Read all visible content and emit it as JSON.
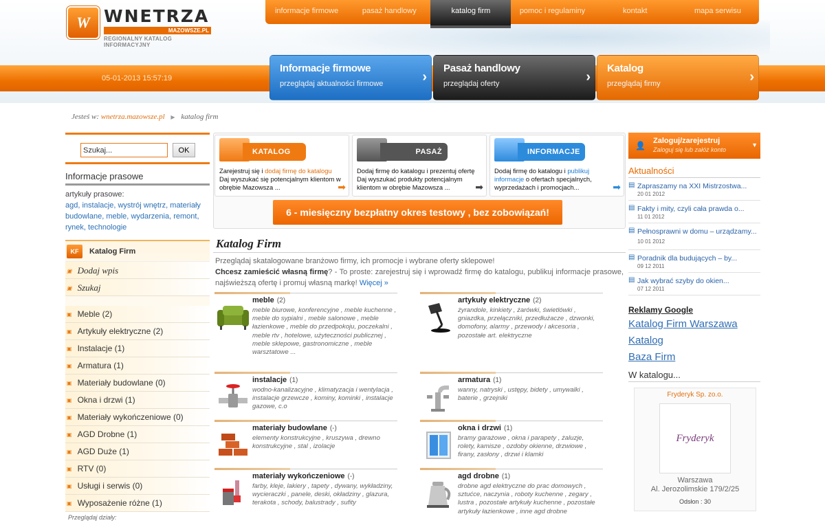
{
  "logo": {
    "word": "WNETRZA",
    "sub": "MAZOWSZE.PL",
    "tagline": "REGIONALNY KATALOG INFORMACYJNY"
  },
  "topnav": [
    {
      "label": "informacje firmowe",
      "active": false
    },
    {
      "label": "pasaż handlowy",
      "active": false
    },
    {
      "label": "katalog firm",
      "active": true
    },
    {
      "label": "pomoc i regulaminy",
      "active": false
    },
    {
      "label": "kontakt",
      "active": false
    },
    {
      "label": "mapa serwisu",
      "active": false
    }
  ],
  "datetime": "05-01-2013 15:57:19",
  "bigtabs": [
    {
      "title": "Informacje firmowe",
      "subtitle": "przeglądaj aktualności firmowe"
    },
    {
      "title": "Pasaż handlowy",
      "subtitle": "przeglądaj oferty"
    },
    {
      "title": "Katalog",
      "subtitle": "przeglądaj firmy"
    }
  ],
  "breadcrumb": {
    "prefix": "Jesteś w:",
    "home": "wnetrza.mazowsze.pl",
    "current": "katalog firm"
  },
  "search": {
    "placeholder": "Szukaj...",
    "value": "Szukaj...",
    "button": "OK"
  },
  "press": {
    "title": "Informacje prasowe",
    "subtitle": "artykuły prasowe:",
    "tags": [
      "agd,",
      "instalacje,",
      "wystrój wnętrz,",
      "materiały budowlane,",
      "meble,",
      "wydarzenia,",
      "remont,",
      "rynek,",
      "technologie"
    ]
  },
  "catalog_panel": {
    "title": "Katalog Firm",
    "badge": "KF",
    "actions": [
      "Dodaj wpis",
      "Szukaj"
    ],
    "categories": [
      "Meble (2)",
      "Artykuły elektryczne (2)",
      "Instalacje (1)",
      "Armatura (1)",
      "Materiały budowlane (0)",
      "Okna i drzwi (1)",
      "Materiały wykończeniowe (0)",
      "AGD Drobne (1)",
      "AGD Duże (1)",
      "RTV (0)",
      "Usługi i serwis (0)",
      "Wyposażenie różne (1)"
    ],
    "footer": "Przeglądaj działy:"
  },
  "promos": [
    {
      "label": "KATALOG",
      "pre": "Zarejestruj się i ",
      "hl": "dodaj firmę do katalogu",
      "post": " Daj wyszukać się potencjalnym klientom w obrębie Mazowsza ...",
      "color": "#f07a12",
      "arrow_color": "#f07a12"
    },
    {
      "label": "PASAŻ",
      "pre": "",
      "hl": "",
      "post": "Dodaj firmę do katalogu i prezentuj ofertę Daj wyszukać produkty potencjalnym klientom w obrębie Mazowsza ...",
      "color": "#555555",
      "arrow_color": "#444444"
    },
    {
      "label": "INFORMACJE",
      "pre": "Dodaj firmę do katalogu i ",
      "hl": "publikuj informacje",
      "post": " o ofertach specjalnych, wyprzedażach i promocjach...",
      "color": "#2d8bdc",
      "arrow_color": "#2d8bdc"
    }
  ],
  "test_banner": "6 - miesięczny bezpłatny okres testowy , bez zobowiązań!",
  "katalog": {
    "title": "Katalog Firm",
    "intro1": "Przeglądaj skatalogowane branżowo firmy, ich promocje i wybrane oferty sklepowe!",
    "bold": "Chcesz zamieścić własną firmę",
    "intro2": "? - To proste: zarejestruj się i wprowadź firmę do katalogu, publikuj informacje prasowe, najświeższą ofertę i promuj własną markę!",
    "more": "Więcej »"
  },
  "categories": [
    {
      "name": "meble",
      "count": "(2)",
      "img": "sofa-icon",
      "desc": "meble biurowe, konferencyjne , meble kuchenne , meble do sypialni , meble salonowe , meble łazienkowe , meble do przedpokoju, poczekalni , meble rtv , hotelowe, użyteczności publicznej , meble sklepowe, gastronomiczne , meble warsztatowe ..."
    },
    {
      "name": "artykuły elektryczne",
      "count": "(2)",
      "img": "lamp-icon",
      "desc": "żyrandole, kinkiety , żarówki, świetlówki , gniazdka, przełączniki, przedłużacze , dzwonki, domofony, alarmy , przewody i akcesoria , pozostałe art. elektryczne"
    },
    {
      "name": "instalacje",
      "count": "(1)",
      "img": "valve-icon",
      "desc": "wodno-kanalizacyjne , klimatyzacja i wentylacja , instalacje grzewcze , kominy, kominki , instalacje gazowe, c.o"
    },
    {
      "name": "armatura",
      "count": "(1)",
      "img": "faucet-icon",
      "desc": "wanny, natryski , ustępy, bidety , umywalki , baterie , grzejniki"
    },
    {
      "name": "materiały budowlane",
      "count": "(-)",
      "img": "bricks-icon",
      "desc": "elementy konstrukcyjne , kruszywa , drewno konstrukcyjne , stal , izolacje"
    },
    {
      "name": "okna i drzwi",
      "count": "(1)",
      "img": "window-icon",
      "desc": "bramy garażowe , okna i parapety , żaluzje, rolety, kamisze , ozdoby okienne, drzwiowe , firany, zasłony , drzwi i klamki"
    },
    {
      "name": "materiały wykończeniowe",
      "count": "(-)",
      "img": "paint-icon",
      "desc": "farby, kleje, lakiery , tapety , dywany, wykładziny, wycieraczki , panele, deski, okładziny , glazura, terakota , schody, balustrady , sufity"
    },
    {
      "name": "agd drobne",
      "count": "(1)",
      "img": "kettle-icon",
      "desc": "drobne agd elektryczne do prac domowych , sztućce, naczynia , roboty kuchenne , zegary , lustra , pozostałe artykuły kuchenne , pozostałe artykuły łazienkowe , inne agd drobne"
    }
  ],
  "login": {
    "title": "Zaloguj/zarejestruj",
    "subtitle": "Zaloguj się lub załóż konto"
  },
  "news": {
    "title": "Aktualności",
    "items": [
      {
        "title": "Zapraszamy na XXI Mistrzostwa...",
        "date": "20 01 2012"
      },
      {
        "title": "Fakty i mity, czyli cała prawda o...",
        "date": "11 01 2012"
      },
      {
        "title": "Pełnosprawni w domu – urządzamy...",
        "date": "10 01 2012"
      },
      {
        "title": "Poradnik dla budujących – by...",
        "date": "09 12 2011"
      },
      {
        "title": "Jak wybrać szyby do okien...",
        "date": "07 12 2011"
      }
    ]
  },
  "google": {
    "title": "Reklamy Google",
    "links": [
      "Katalog Firm Warszawa",
      "Katalog",
      "Baza Firm"
    ]
  },
  "in_catalog": {
    "title": "W katalogu...",
    "firm": "Fryderyk Sp. zo.o.",
    "logo_text": "Fryderyk",
    "city": "Warszawa",
    "address": "Al. Jerozolimskie 179/2/25",
    "visits": "Odsłon : 30"
  }
}
